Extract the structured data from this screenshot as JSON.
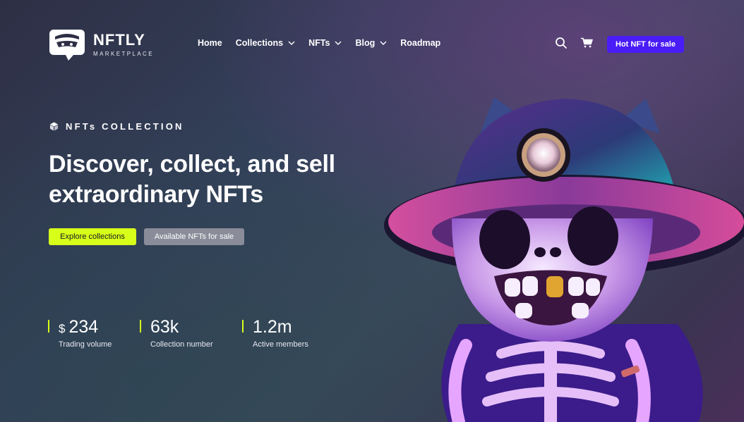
{
  "brand": {
    "name": "NFTLY",
    "tagline": "MARKETPLACE"
  },
  "nav": {
    "items": [
      {
        "label": "Home",
        "dropdown": false
      },
      {
        "label": "Collections",
        "dropdown": true
      },
      {
        "label": "NFTs",
        "dropdown": true
      },
      {
        "label": "Blog",
        "dropdown": true
      },
      {
        "label": "Roadmap",
        "dropdown": false
      }
    ]
  },
  "header": {
    "cta_label": "Hot NFT for sale",
    "icons": [
      "search-icon",
      "cart-icon"
    ]
  },
  "hero": {
    "eyebrow": "NFTs COLLECTION",
    "headline_line1": "Discover, collect, and sell",
    "headline_line2": "extraordinary NFTs",
    "primary_button": "Explore collections",
    "secondary_button": "Available NFTs for sale"
  },
  "stats": [
    {
      "currency": "$",
      "value": "234",
      "label": "Trading volume"
    },
    {
      "currency": "",
      "value": "63k",
      "label": "Collection number"
    },
    {
      "currency": "",
      "value": "1.2m",
      "label": "Active members"
    }
  ],
  "colors": {
    "accent_lime": "#d7ff1a",
    "accent_violet": "#4a1cf6",
    "secondary_gray": "#8a8c99"
  }
}
